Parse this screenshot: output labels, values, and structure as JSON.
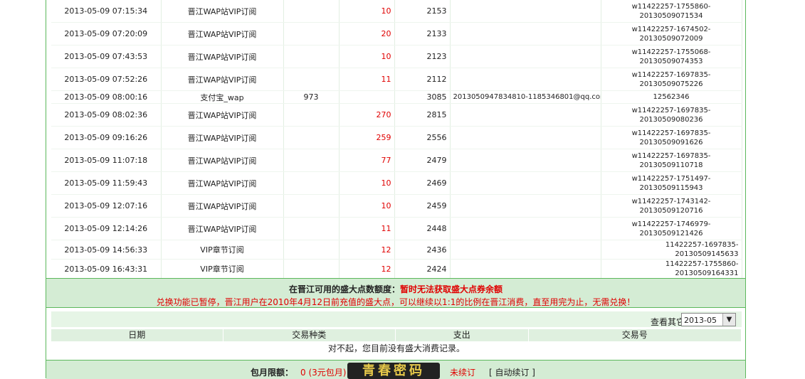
{
  "transactions": [
    {
      "time": "2013-05-09 07:15:34",
      "type": "晋江WAP站VIP订阅",
      "a": "",
      "b": "10",
      "c": "2153",
      "d": "",
      "e": "w11422257-1755860-20130509071534"
    },
    {
      "time": "2013-05-09 07:20:09",
      "type": "晋江WAP站VIP订阅",
      "a": "",
      "b": "20",
      "c": "2133",
      "d": "",
      "e": "w11422257-1674502-20130509072009"
    },
    {
      "time": "2013-05-09 07:43:53",
      "type": "晋江WAP站VIP订阅",
      "a": "",
      "b": "10",
      "c": "2123",
      "d": "",
      "e": "w11422257-1755068-20130509074353"
    },
    {
      "time": "2013-05-09 07:52:26",
      "type": "晋江WAP站VIP订阅",
      "a": "",
      "b": "11",
      "c": "2112",
      "d": "",
      "e": "w11422257-1697835-20130509075226"
    },
    {
      "time": "2013-05-09 08:00:16",
      "type": "支付宝_wap",
      "a": "973",
      "b": "",
      "c": "3085",
      "d": "2013050947834810-1185346801@qq.com",
      "e": "12562346"
    },
    {
      "time": "2013-05-09 08:02:36",
      "type": "晋江WAP站VIP订阅",
      "a": "",
      "b": "270",
      "c": "2815",
      "d": "",
      "e": "w11422257-1697835-20130509080236"
    },
    {
      "time": "2013-05-09 09:16:26",
      "type": "晋江WAP站VIP订阅",
      "a": "",
      "b": "259",
      "c": "2556",
      "d": "",
      "e": "w11422257-1697835-20130509091626"
    },
    {
      "time": "2013-05-09 11:07:18",
      "type": "晋江WAP站VIP订阅",
      "a": "",
      "b": "77",
      "c": "2479",
      "d": "",
      "e": "w11422257-1697835-20130509110718"
    },
    {
      "time": "2013-05-09 11:59:43",
      "type": "晋江WAP站VIP订阅",
      "a": "",
      "b": "10",
      "c": "2469",
      "d": "",
      "e": "w11422257-1751497-20130509115943"
    },
    {
      "time": "2013-05-09 12:07:16",
      "type": "晋江WAP站VIP订阅",
      "a": "",
      "b": "10",
      "c": "2459",
      "d": "",
      "e": "w11422257-1743142-20130509120716"
    },
    {
      "time": "2013-05-09 12:14:26",
      "type": "晋江WAP站VIP订阅",
      "a": "",
      "b": "11",
      "c": "2448",
      "d": "",
      "e": "w11422257-1746979-20130509121426"
    },
    {
      "time": "2013-05-09 14:56:33",
      "type": "VIP章节订阅",
      "a": "",
      "b": "12",
      "c": "2436",
      "d": "",
      "e": "11422257-1697835-20130509145633"
    },
    {
      "time": "2013-05-09 16:43:31",
      "type": "VIP章节订阅",
      "a": "",
      "b": "12",
      "c": "2424",
      "d": "",
      "e": "11422257-1755860-20130509164331"
    }
  ],
  "info": {
    "label": "在晋江可用的盛大点数额度：",
    "status": "暂时无法获取盛大点券余额",
    "notice": "兑换功能已暂停，晋江用户在2010年4月12日前充值的盛大点，可以继续以1:1的比例在晋江消费，直至用完为止，无需兑换！"
  },
  "month_filter": {
    "label": "查看其它月份",
    "selected": "2013-05"
  },
  "sd_table": {
    "headers": [
      "日期",
      "交易种类",
      "支出",
      "交易号"
    ],
    "empty_message": "对不起，您目前没有盛大消费记录。"
  },
  "bottom": {
    "label": "包月限额：",
    "value": "0 (3元包月)",
    "status": "未续订",
    "auto_renew": "[ 自动续订 ]",
    "watermark": "青春密码"
  }
}
